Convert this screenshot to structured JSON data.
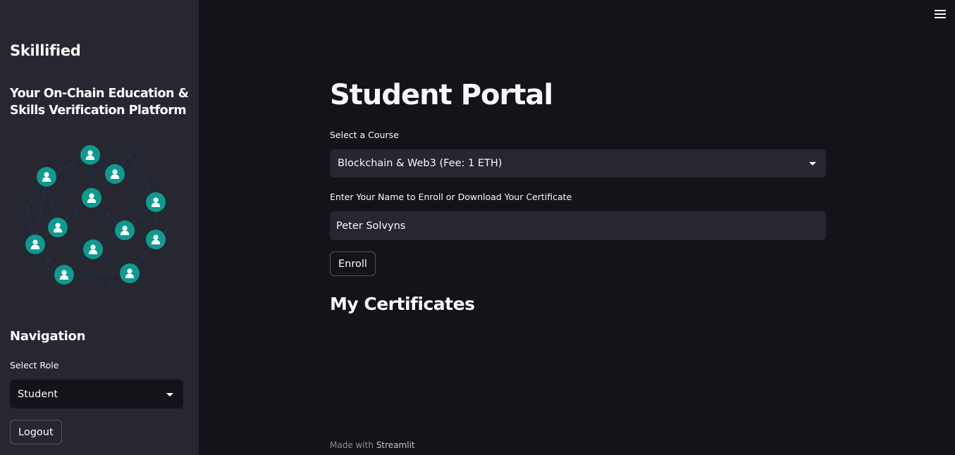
{
  "sidebar": {
    "app_title": "Skillified",
    "tagline": "Your On-Chain Education & Skills Verification Platform",
    "illustration_icon": "user-network-illustration",
    "navigation": {
      "heading": "Navigation",
      "role_label": "Select Role",
      "role_value": "Student"
    },
    "logout_label": "Logout"
  },
  "header": {
    "menu_icon": "hamburger-menu-icon"
  },
  "main": {
    "title": "Student Portal",
    "course": {
      "label": "Select a Course",
      "selected": "Blockchain & Web3 (Fee: 1 ETH)"
    },
    "name": {
      "label": "Enter Your Name to Enroll or Download Your Certificate",
      "value": "Peter Solvyns"
    },
    "enroll_label": "Enroll",
    "certificates_heading": "My Certificates"
  },
  "footer": {
    "prefix": "Made with",
    "link": "Streamlit"
  },
  "colors": {
    "background": "#131419",
    "sidebar": "#262730",
    "node": "#0e9a8f",
    "text": "#fafafa"
  }
}
